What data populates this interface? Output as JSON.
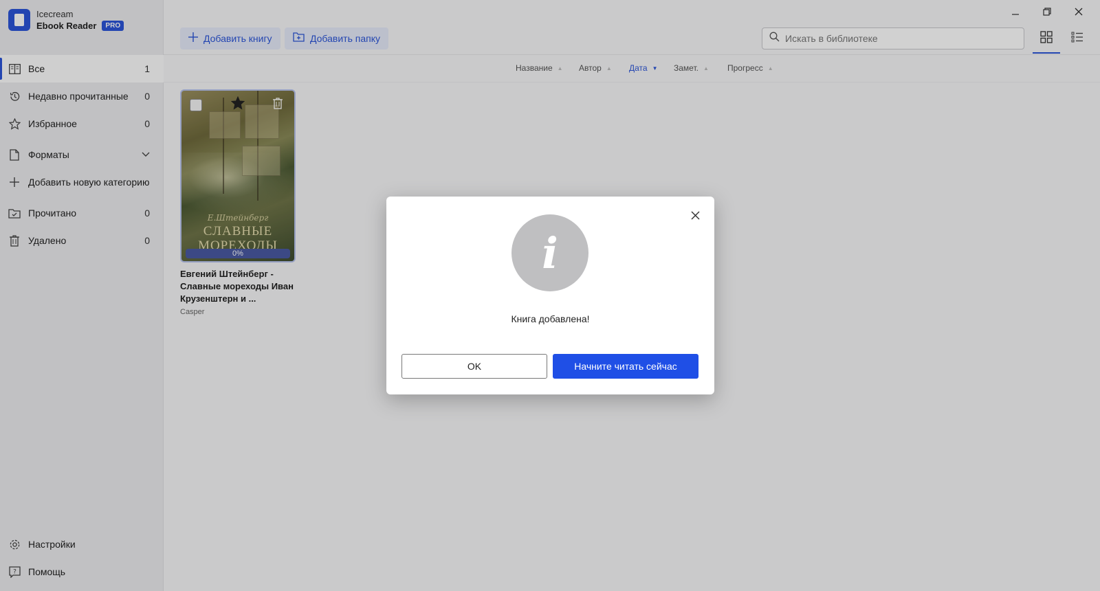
{
  "app": {
    "name_line1": "Icecream",
    "name_line2": "Ebook Reader",
    "badge": "PRO",
    "accent_color": "#2b55d8"
  },
  "window_controls": {
    "minimize_icon": "minimize-icon",
    "restore_icon": "restore-icon",
    "close_icon": "close-icon"
  },
  "toolbar": {
    "add_book_label": "Добавить книгу",
    "add_folder_label": "Добавить папку",
    "search_placeholder": "Искать в библиотеке",
    "view_grid": "grid-view-icon",
    "view_list": "list-view-icon"
  },
  "sidebar": {
    "items": [
      {
        "label": "Все",
        "count": "1",
        "icon": "books-icon"
      },
      {
        "label": "Недавно прочитанные",
        "count": "0",
        "icon": "history-icon"
      },
      {
        "label": "Избранное",
        "count": "0",
        "icon": "star-icon"
      },
      {
        "label": "Форматы",
        "count": "",
        "icon": "file-icon"
      },
      {
        "label": "Добавить новую категорию",
        "count": "",
        "icon": "plus-icon"
      },
      {
        "label": "Прочитано",
        "count": "0",
        "icon": "folder-check-icon"
      },
      {
        "label": "Удалено",
        "count": "0",
        "icon": "trash-icon"
      }
    ],
    "bottom": [
      {
        "label": "Настройки",
        "icon": "gear-icon"
      },
      {
        "label": "Помощь",
        "icon": "help-icon"
      }
    ]
  },
  "sort": {
    "columns": [
      "Название",
      "Автор",
      "Дата",
      "Замет.",
      "Прогресс"
    ],
    "active": "Дата"
  },
  "books": [
    {
      "title": "Евгений Штейнберг - Славные мореходы Иван Крузенштерн и ...",
      "author": "Casper",
      "cover_author": "Е.Штейнберг",
      "cover_title_1": "СЛАВНЫЕ",
      "cover_title_2": "МОРЕХОДЫ",
      "progress": "0%"
    }
  ],
  "dialog": {
    "message": "Книга добавлена!",
    "ok_label": "OK",
    "read_label": "Начните читать сейчас",
    "icon": "info-icon"
  }
}
